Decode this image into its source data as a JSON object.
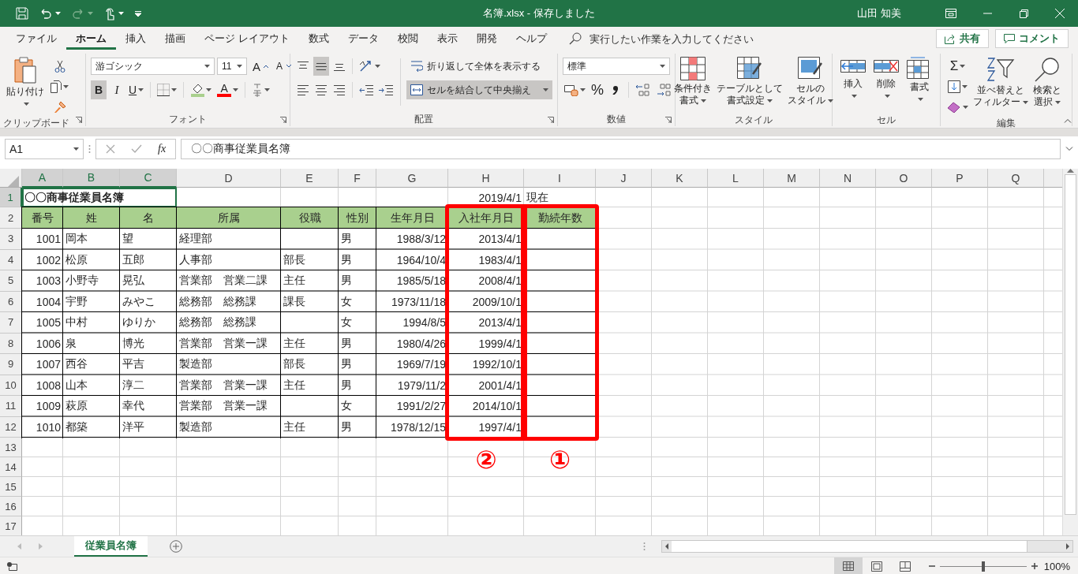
{
  "title_bar": {
    "document": "名簿.xlsx  -  保存しました",
    "user": "山田 知美"
  },
  "menu_tabs": [
    {
      "label": "ファイル",
      "selected": false
    },
    {
      "label": "ホーム",
      "selected": true
    },
    {
      "label": "挿入",
      "selected": false
    },
    {
      "label": "描画",
      "selected": false
    },
    {
      "label": "ページ レイアウト",
      "selected": false
    },
    {
      "label": "数式",
      "selected": false
    },
    {
      "label": "データ",
      "selected": false
    },
    {
      "label": "校閲",
      "selected": false
    },
    {
      "label": "表示",
      "selected": false
    },
    {
      "label": "開発",
      "selected": false
    },
    {
      "label": "ヘルプ",
      "selected": false
    }
  ],
  "tell_me": {
    "placeholder": "実行したい作業を入力してください"
  },
  "share": "共有",
  "comment": "コメント",
  "ribbon": {
    "clipboard": {
      "label": "クリップボード",
      "paste": "貼り付け"
    },
    "font": {
      "label": "フォント",
      "name": "游ゴシック",
      "size": "11",
      "grow": "A",
      "shrink": "A",
      "bold": {
        "text": "B",
        "selected": true
      },
      "italic": "I",
      "underline": "U",
      "color_letter": "A"
    },
    "alignment": {
      "label": "配置",
      "vertical": [
        {
          "kind": "top",
          "selected": false
        },
        {
          "kind": "middle",
          "selected": true
        },
        {
          "kind": "bottom",
          "selected": false
        }
      ],
      "wrap": "折り返して全体を表示する",
      "merge": {
        "label": "セルを結合して中央揃え",
        "selected": true
      }
    },
    "number": {
      "label": "数値",
      "format": "標準",
      "percent": "%"
    },
    "styles": {
      "label": "スタイル",
      "buttons": [
        [
          "条件付き",
          "書式"
        ],
        [
          "テーブルとして",
          "書式設定"
        ],
        [
          "セルの",
          "スタイル"
        ]
      ]
    },
    "cells": {
      "label": "セル",
      "buttons": [
        "挿入",
        "削除",
        "書式"
      ]
    },
    "editing": {
      "label": "編集",
      "autosum": "Σ",
      "buttons": [
        [
          "並べ替えと",
          "フィルター"
        ],
        [
          "検索と",
          "選択"
        ]
      ]
    }
  },
  "formula_bar": {
    "name_box": "A1",
    "fx": "fx",
    "value": "〇〇商事従業員名簿"
  },
  "sheet": {
    "columns": [
      {
        "label": "A",
        "selected": true
      },
      {
        "label": "B",
        "selected": true
      },
      {
        "label": "C",
        "selected": true
      },
      {
        "label": "D",
        "selected": false
      },
      {
        "label": "E",
        "selected": false
      },
      {
        "label": "F",
        "selected": false
      },
      {
        "label": "G",
        "selected": false
      },
      {
        "label": "H",
        "selected": false,
        "highlight": "②"
      },
      {
        "label": "I",
        "selected": false,
        "highlight": "①"
      },
      {
        "label": "J",
        "selected": false
      },
      {
        "label": "K",
        "selected": false
      },
      {
        "label": "L",
        "selected": false
      },
      {
        "label": "M",
        "selected": false
      },
      {
        "label": "N",
        "selected": false
      },
      {
        "label": "O",
        "selected": false
      },
      {
        "label": "P",
        "selected": false
      },
      {
        "label": "Q",
        "selected": false
      }
    ],
    "row_headers": [
      {
        "label": "1",
        "selected": true
      },
      {
        "label": "2",
        "selected": false
      },
      {
        "label": "3",
        "selected": false
      },
      {
        "label": "4",
        "selected": false
      },
      {
        "label": "5",
        "selected": false
      },
      {
        "label": "6",
        "selected": false
      },
      {
        "label": "7",
        "selected": false
      },
      {
        "label": "8",
        "selected": false
      },
      {
        "label": "9",
        "selected": false
      },
      {
        "label": "10",
        "selected": false
      },
      {
        "label": "11",
        "selected": false
      },
      {
        "label": "12",
        "selected": false
      },
      {
        "label": "13",
        "selected": false
      },
      {
        "label": "14",
        "selected": false
      },
      {
        "label": "15",
        "selected": false
      },
      {
        "label": "16",
        "selected": false
      },
      {
        "label": "17",
        "selected": false
      }
    ],
    "title_cell": {
      "text": "〇〇商事従業員名簿",
      "selected": true
    },
    "as_of": {
      "date": "2019/4/1",
      "suffix": "現在"
    },
    "header_row": [
      "番号",
      "姓",
      "名",
      "所属",
      "役職",
      "性別",
      "生年月日",
      "入社年月日",
      "勤続年数"
    ],
    "records": [
      {
        "num": "1001",
        "sei": "岡本",
        "mei": "望",
        "dept": "経理部",
        "sex": "男",
        "birth": "1988/3/12",
        "hired": "2013/4/1"
      },
      {
        "num": "1002",
        "sei": "松原",
        "mei": "五郎",
        "dept": "人事部",
        "post": "部長",
        "sex": "男",
        "birth": "1964/10/4",
        "hired": "1983/4/1"
      },
      {
        "num": "1003",
        "sei": "小野寺",
        "mei": "晃弘",
        "dept": "営業部　営業二課",
        "post": "主任",
        "sex": "男",
        "birth": "1985/5/18",
        "hired": "2008/4/1"
      },
      {
        "num": "1004",
        "sei": "宇野",
        "mei": "みやこ",
        "dept": "総務部　総務課",
        "post": "課長",
        "sex": "女",
        "birth": "1973/11/18",
        "hired": "2009/10/1"
      },
      {
        "num": "1005",
        "sei": "中村",
        "mei": "ゆりか",
        "dept": "総務部　総務課",
        "sex": "女",
        "birth": "1994/8/5",
        "hired": "2013/4/1"
      },
      {
        "num": "1006",
        "sei": "泉",
        "mei": "博光",
        "dept": "営業部　営業一課",
        "post": "主任",
        "sex": "男",
        "birth": "1980/4/26",
        "hired": "1999/4/1"
      },
      {
        "num": "1007",
        "sei": "西谷",
        "mei": "平吉",
        "dept": "製造部",
        "post": "部長",
        "sex": "男",
        "birth": "1969/7/19",
        "hired": "1992/10/1"
      },
      {
        "num": "1008",
        "sei": "山本",
        "mei": "淳二",
        "dept": "営業部　営業一課",
        "post": "主任",
        "sex": "男",
        "birth": "1979/11/2",
        "hired": "2001/4/1"
      },
      {
        "num": "1009",
        "sei": "萩原",
        "mei": "幸代",
        "dept": "営業部　営業一課",
        "sex": "女",
        "birth": "1991/2/27",
        "hired": "2014/10/1"
      },
      {
        "num": "1010",
        "sei": "都築",
        "mei": "洋平",
        "dept": "製造部",
        "post": "主任",
        "sex": "男",
        "birth": "1978/12/15",
        "hired": "1997/4/1"
      }
    ]
  },
  "sheet_tabs": [
    {
      "label": "従業員名簿",
      "selected": true
    }
  ],
  "status_bar": {
    "views": [
      {
        "kind": "normal",
        "selected": true
      },
      {
        "kind": "page_layout",
        "selected": false
      },
      {
        "kind": "page_break",
        "selected": false
      }
    ],
    "zoom": {
      "level": 0.5,
      "reading": "100%"
    }
  }
}
